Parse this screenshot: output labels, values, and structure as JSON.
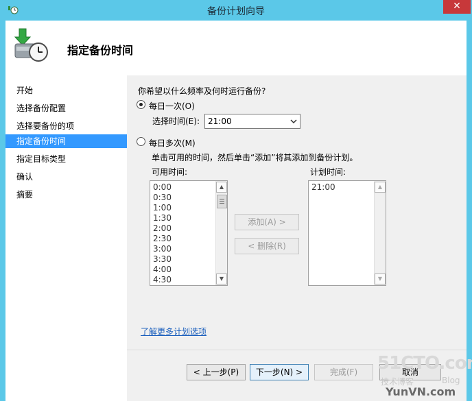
{
  "window": {
    "title": "备份计划向导",
    "close_glyph": "✕"
  },
  "header": {
    "title": "指定备份时间",
    "icon": "backup-clock-icon"
  },
  "sidebar": {
    "items": [
      {
        "label": "开始"
      },
      {
        "label": "选择备份配置"
      },
      {
        "label": "选择要备份的项"
      },
      {
        "label": "指定备份时间",
        "active": true
      },
      {
        "label": "指定目标类型"
      },
      {
        "label": "确认"
      },
      {
        "label": "摘要"
      }
    ]
  },
  "main": {
    "question": "你希望以什么频率及何时运行备份?",
    "option_daily": "每日一次(O)",
    "select_time_label": "选择时间(E):",
    "select_time_value": "21:00",
    "option_multi": "每日多次(M)",
    "instruction": "单击可用的时间，然后单击“添加”将其添加到备份计划。",
    "available_label": "可用时间:",
    "scheduled_label": "计划时间:",
    "available_times": [
      "0:00",
      "0:30",
      "1:00",
      "1:30",
      "2:00",
      "2:30",
      "3:00",
      "3:30",
      "4:00",
      "4:30"
    ],
    "scheduled_times": [
      "21:00"
    ],
    "add_label": "添加(A) >",
    "remove_label": "< 删除(R)",
    "learn_more": "了解更多计划选项"
  },
  "footer": {
    "back_label": "< 上一步(P)",
    "next_label": "下一步(N) >",
    "finish_label": "完成(F)",
    "cancel_label": "取消"
  },
  "watermark": {
    "line1": "51CTO.com",
    "line2": "技术博客",
    "blog": "Blog",
    "line3": "YunVN.com"
  },
  "colors": {
    "title_bar": "#5bc8e8",
    "selection": "#3399ff",
    "close": "#c7383a",
    "link": "#1b5fbd"
  }
}
